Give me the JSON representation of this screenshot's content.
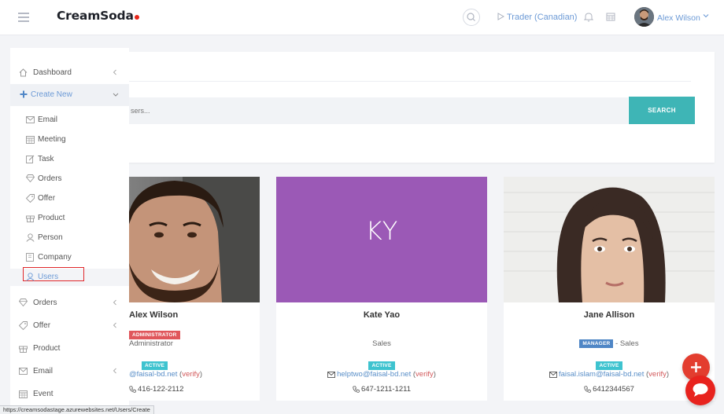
{
  "header": {
    "brand": "CreamSoda",
    "trader": "Trader (Canadian)",
    "user_name": "Alex Wilson"
  },
  "search": {
    "placeholder": "sers...",
    "button_label": "SEARCH"
  },
  "sidebar": {
    "items": [
      {
        "label": "Dashboard",
        "icon": "home-icon",
        "has_caret": true
      },
      {
        "label": "Create New",
        "icon": "plus-icon",
        "expanded": true
      }
    ],
    "create_new_items": [
      {
        "label": "Email",
        "icon": "envelope-icon"
      },
      {
        "label": "Meeting",
        "icon": "calendar-icon"
      },
      {
        "label": "Task",
        "icon": "edit-icon"
      },
      {
        "label": "Orders",
        "icon": "diamond-icon"
      },
      {
        "label": "Offer",
        "icon": "tag-icon"
      },
      {
        "label": "Product",
        "icon": "gift-icon"
      },
      {
        "label": "Person",
        "icon": "person-icon"
      },
      {
        "label": "Company",
        "icon": "building-icon"
      },
      {
        "label": "Users",
        "icon": "users-icon",
        "selected": true
      }
    ],
    "lower_items": [
      {
        "label": "Orders",
        "icon": "diamond-icon",
        "has_caret": true
      },
      {
        "label": "Offer",
        "icon": "tag-icon",
        "has_caret": true
      },
      {
        "label": "Product",
        "icon": "gift-icon"
      },
      {
        "label": "Email",
        "icon": "envelope-icon",
        "has_caret": true
      },
      {
        "label": "Event",
        "icon": "calendar-icon"
      }
    ]
  },
  "cards": [
    {
      "name": "Alex Wilson",
      "role_badge": "ADMINISTRATOR",
      "role": "Administrator",
      "status": "ACTIVE",
      "email": "@faisal-bd.net",
      "verify": "verify",
      "phone": "416-122-2112"
    },
    {
      "initials": "KY",
      "initials_bg": "#9b59b6",
      "name": "Kate Yao",
      "role": "Sales",
      "status": "ACTIVE",
      "email": "helptwo@faisal-bd.net",
      "verify": "verify",
      "phone": "647-1211-1211"
    },
    {
      "name": "Jane Allison",
      "role_badge": "MANAGER",
      "role": "- Sales",
      "status": "ACTIVE",
      "email": "faisal.islam@faisal-bd.net",
      "verify": "verify",
      "phone": "6412344567"
    }
  ],
  "status_bar": {
    "url": "https://creamsodastage.azurewebsites.net/Users/Create"
  },
  "colors": {
    "accent": "#6c9ad6",
    "search_button": "#3eb5b6",
    "active_badge": "#3ec3cf",
    "admin_badge": "#e0565b",
    "manager_badge": "#4f86c6",
    "fab": "#e33d2f"
  }
}
